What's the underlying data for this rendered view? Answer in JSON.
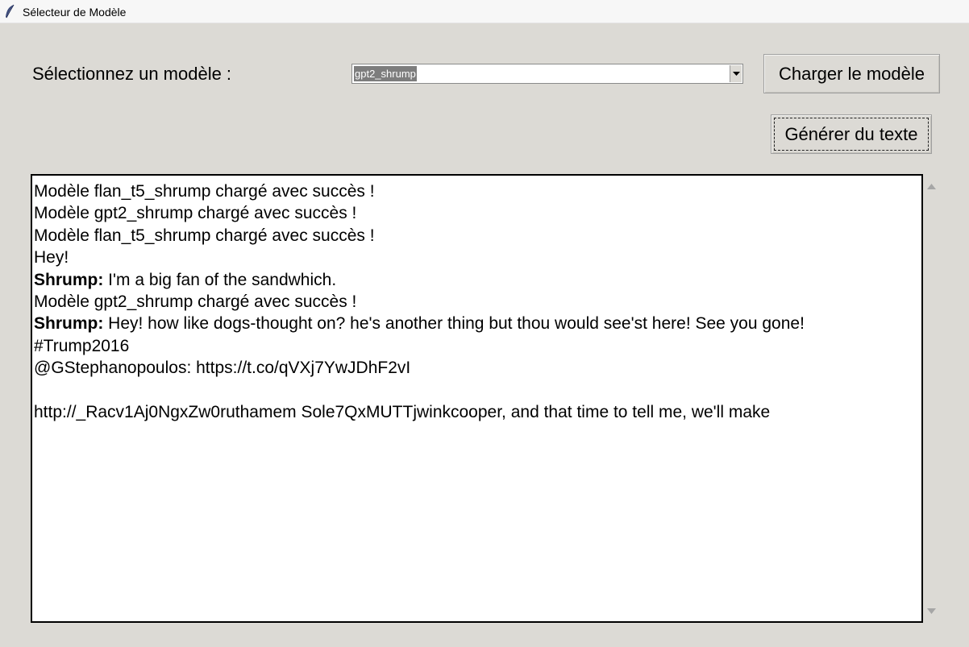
{
  "window": {
    "title": "Sélecteur de Modèle",
    "icon": "feather-icon"
  },
  "form": {
    "select_label": "Sélectionnez un modèle :",
    "model_combo": {
      "selected": "gpt2_shrump"
    },
    "load_button_label": "Charger le modèle",
    "generate_button_label": "Générer du texte"
  },
  "output": {
    "lines": [
      {
        "speaker": "",
        "text": "Modèle flan_t5_shrump chargé avec succès !"
      },
      {
        "speaker": "",
        "text": "Modèle gpt2_shrump chargé avec succès !"
      },
      {
        "speaker": "",
        "text": "Modèle flan_t5_shrump chargé avec succès !"
      },
      {
        "speaker": "",
        "text": "Hey!"
      },
      {
        "speaker": "Shrump:",
        "text": " I'm a big fan of the sandwhich."
      },
      {
        "speaker": "",
        "text": "Modèle gpt2_shrump chargé avec succès !"
      },
      {
        "speaker": "Shrump:",
        "text": " Hey! how like dogs-thought on? he's another thing but thou would see'st here! See you gone!"
      },
      {
        "speaker": "",
        "text": "#Trump2016"
      },
      {
        "speaker": "",
        "text": "@GStephanopoulos: https://t.co/qVXj7YwJDhF2vI"
      },
      {
        "speaker": "",
        "text": ""
      },
      {
        "speaker": "",
        "text": "http://_Racv1Aj0NgxZw0ruthamem Sole7QxMUTTjwinkcooper, and that time to tell me, we'll make"
      }
    ]
  },
  "colors": {
    "window_bg": "#dcdad5",
    "selection_bg": "#7d7d7d"
  }
}
